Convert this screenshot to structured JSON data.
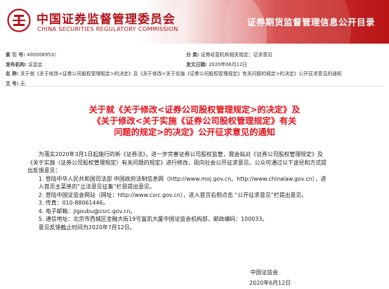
{
  "header": {
    "logo_cn": "中国证券监督管理委员会",
    "logo_en": "CHINA SECURITIES REGULATORY COMMISSION",
    "site_title": "证券期货监督管理信息公开目录",
    "colors": {
      "brand_red": "#b3131a",
      "title_red": "#e5121a"
    }
  },
  "meta": {
    "index_label": "索 引 号:",
    "index_value": "40000895X/",
    "category_label": "分 类:",
    "category_value": "证券经营机构相关规定；征求意见",
    "publisher_label": "发布机构:",
    "publisher_value": "证监会",
    "date_label": "发文日期:",
    "date_value": "2020年06月12日",
    "name_label": "名 称:",
    "name_value": "关于就《关于修改<证券公司股权管理规定>的决定》及《关于修改<关于实施《证券公司股权管理规定》有关问题的规定>的决定》公开征求意见的通知",
    "number_label": "文 号:",
    "number_value": "无"
  },
  "document": {
    "title_lines": [
      "关于就《关于修改<证券公司股权管理规定>的决定》及",
      "《关于修改<关于实施《证券公司股权管理规定》有关",
      "问题的规定>的决定》公开征求意见的通知"
    ],
    "intro_line1": "为落实2020年3月1日起施行的新《证券法》，进一步完善证券公司股权监管，我会拟对《证券公司股权管理规定》及",
    "intro_line2": "《关于实施〈证券公司股权管理规定〉有关问题的规定》进行修改，现向社会公开征求意见。公众可通过以下途径和方式提",
    "intro_line3": "出反馈意见：",
    "item1_line1": "1. 登陆中华人民共和国司法部 中国政府法制信息网（http://www.moj.gov.cn、http://www.chinalaw.gov.cn），进",
    "item1_line2": "入首页主菜单的“立法意见征集”栏目提出意见。",
    "item2": "2. 登陆中国证监会网站（网址：http://www.csrc.gov.cn），进入首页右侧点击 “公开征求意见”栏提出意见。",
    "item3": "3. 传真：010-88061446。",
    "item4": "4. 电子邮箱：jigoubu@csrc.gov.cn。",
    "item5": "5. 通信地址：北京市西城区金融大街19号富凯大厦中国证监会机构部，邮政编码：100033。",
    "deadline": "意见反馈截止时间为2020年7月12日。",
    "signature": "中国证监会",
    "sign_date": "2020年6月12日"
  }
}
